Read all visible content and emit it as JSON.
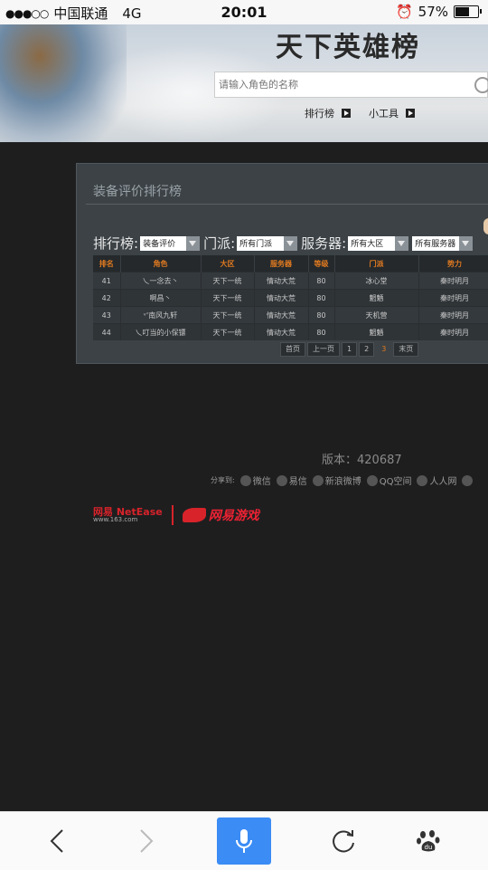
{
  "status_bar": {
    "carrier": "中国联通",
    "network": "4G",
    "time": "20:01",
    "battery": "57%",
    "signal_dots": "●●●○○"
  },
  "banner": {
    "title": "天下英雄榜",
    "search_placeholder": "请输入角色的名称",
    "links": [
      "排行榜",
      "小工具"
    ]
  },
  "panel": {
    "title": "装备评价排行榜",
    "filters": {
      "ranking_label": "排行榜:",
      "ranking_value": "装备评价",
      "faction_label": "门派:",
      "faction_value": "所有门派",
      "server_label": "服务器:",
      "region_value": "所有大区",
      "server_value": "所有服务器"
    },
    "table": {
      "headers": [
        "排名",
        "角色",
        "大区",
        "服务器",
        "等级",
        "门派",
        "势力"
      ],
      "rows": [
        [
          "41",
          "乀一念去丶",
          "天下一统",
          "情动大荒",
          "80",
          "冰心堂",
          "秦时明月"
        ],
        [
          "42",
          "啊昌丶",
          "天下一统",
          "情动大荒",
          "80",
          "魍魉",
          "秦时明月"
        ],
        [
          "43",
          "ᵛ'南风九轩",
          "天下一统",
          "情动大荒",
          "80",
          "天机营",
          "秦时明月"
        ],
        [
          "44",
          "乀叮当的小保镖",
          "天下一统",
          "情动大荒",
          "80",
          "魍魉",
          "秦时明月"
        ]
      ]
    },
    "pager": {
      "first": "首页",
      "prev": "上一页",
      "pages": [
        "1",
        "2",
        "3"
      ],
      "current": "3",
      "last": "末页"
    }
  },
  "footer": {
    "version": "版本：420687",
    "share_label": "分享到:",
    "share_items": [
      "微信",
      "易信",
      "新浪微博",
      "QQ空间",
      "人人网"
    ],
    "netease_logo": "网易 NetEase",
    "netease_url": "www.163.com",
    "game_logo": "网易游戏"
  },
  "colors": {
    "accent_orange": "#e07a20",
    "mic_blue": "#3b8cf5",
    "panel_bg": "#3c4246",
    "page_bg": "#1e1e1f"
  }
}
